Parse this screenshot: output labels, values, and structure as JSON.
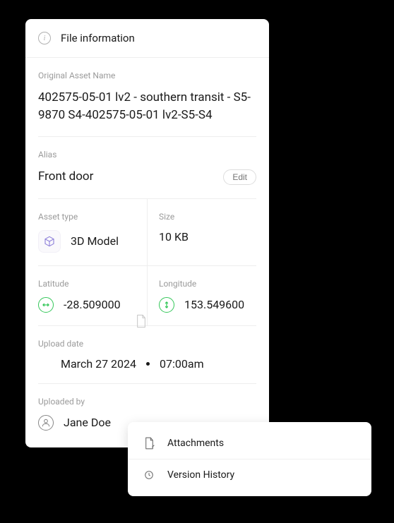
{
  "header": {
    "title": "File information"
  },
  "original": {
    "label": "Original Asset Name",
    "value": "402575-05-01 lv2 - southern transit - S5-9870 S4-402575-05-01 lv2-S5-S4"
  },
  "alias": {
    "label": "Alias",
    "value": "Front door",
    "edit_label": "Edit"
  },
  "asset_type": {
    "label": "Asset type",
    "value": "3D Model"
  },
  "size": {
    "label": "Size",
    "value": "10 KB"
  },
  "latitude": {
    "label": "Latitude",
    "value": "-28.509000"
  },
  "longitude": {
    "label": "Longitude",
    "value": "153.549600"
  },
  "upload_date": {
    "label": "Upload date",
    "date": "March 27 2024",
    "time": "07:00am"
  },
  "uploaded_by": {
    "label": "Uploaded by",
    "value": "Jane Doe"
  },
  "menu": {
    "attachments": "Attachments",
    "version_history": "Version History"
  }
}
